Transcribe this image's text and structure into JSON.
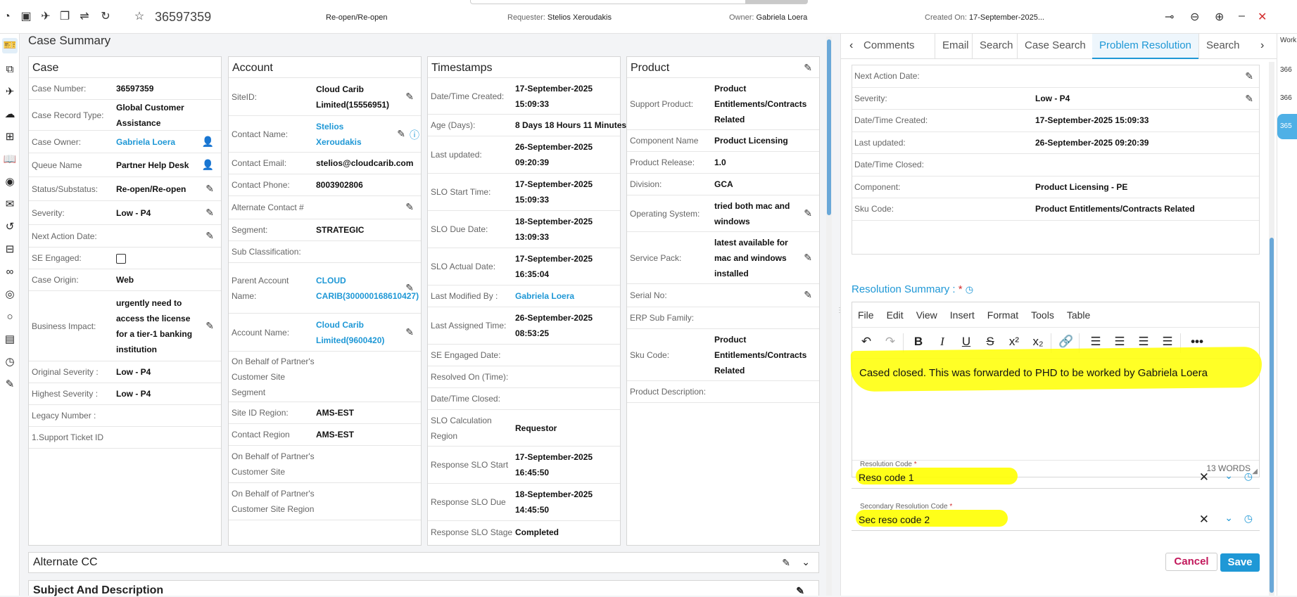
{
  "topbar": {
    "case_id": "36597359",
    "status": "Re-open/Re-open",
    "requester_label": "Requester:",
    "requester": "Stelios Xeroudakis",
    "owner_label": "Owner:",
    "owner": "Gabriela Loera",
    "created_label": "Created On:",
    "created": "17-September-2025..."
  },
  "page_title": "Case Summary",
  "case_panel": {
    "title": "Case",
    "rows": [
      {
        "label": "Case Number:",
        "value": "36597359"
      },
      {
        "label": "Case Record Type:",
        "value": "Global Customer Assistance"
      },
      {
        "label": "Case Owner:",
        "value": "Gabriela Loera"
      },
      {
        "label": "Queue Name",
        "value": "Partner Help Desk"
      },
      {
        "label": "Status/Substatus:",
        "value": "Re-open/Re-open"
      },
      {
        "label": "Severity:",
        "value": "Low - P4"
      },
      {
        "label": "Next Action Date:",
        "value": ""
      },
      {
        "label": "SE Engaged:",
        "value": ""
      },
      {
        "label": "Case Origin:",
        "value": "Web"
      },
      {
        "label": "Business Impact:",
        "value": "urgently need to access the license for a tier-1 banking institution"
      },
      {
        "label": "Original Severity :",
        "value": "Low - P4"
      },
      {
        "label": "Highest Severity :",
        "value": "Low - P4"
      },
      {
        "label": "Legacy Number :",
        "value": ""
      },
      {
        "label": "1.Support Ticket ID",
        "value": ""
      }
    ]
  },
  "account_panel": {
    "title": "Account",
    "rows": [
      {
        "label": "SiteID:",
        "value": "Cloud Carib Limited(15556951)"
      },
      {
        "label": "Contact Name:",
        "value": "Stelios Xeroudakis"
      },
      {
        "label": "Contact Email:",
        "value": "stelios@cloudcarib.com"
      },
      {
        "label": "Contact Phone:",
        "value": "8003902806"
      },
      {
        "label": "Alternate Contact #",
        "value": ""
      },
      {
        "label": "Segment:",
        "value": "STRATEGIC"
      },
      {
        "label": "Sub Classification:",
        "value": ""
      },
      {
        "label": "Parent Account Name:",
        "value": "CLOUD CARIB(300000168610427)"
      },
      {
        "label": "Account Name:",
        "value": "Cloud Carib Limited(9600420)"
      },
      {
        "label": "On Behalf of Partner's Customer Site Segment",
        "value": ""
      },
      {
        "label": "Site ID Region:",
        "value": "AMS-EST"
      },
      {
        "label": "Contact Region",
        "value": "AMS-EST"
      },
      {
        "label": "On Behalf of Partner's Customer Site",
        "value": ""
      },
      {
        "label": "On Behalf of Partner's Customer Site Region",
        "value": ""
      }
    ]
  },
  "timestamps_panel": {
    "title": "Timestamps",
    "rows": [
      {
        "label": "Date/Time Created:",
        "value": "17-September-2025 15:09:33"
      },
      {
        "label": "Age (Days):",
        "value": "8 Days 18 Hours 11 Minutes"
      },
      {
        "label": "Last updated:",
        "value": "26-September-2025 09:20:39"
      },
      {
        "label": "SLO Start Time:",
        "value": "17-September-2025 15:09:33"
      },
      {
        "label": "SLO Due Date:",
        "value": "18-September-2025 13:09:33"
      },
      {
        "label": "SLO Actual Date:",
        "value": "17-September-2025 16:35:04"
      },
      {
        "label": "Last Modified By :",
        "value": "Gabriela Loera"
      },
      {
        "label": "Last Assigned Time:",
        "value": "26-September-2025 08:53:25"
      },
      {
        "label": "SE Engaged Date:",
        "value": ""
      },
      {
        "label": "Resolved On (Time):",
        "value": ""
      },
      {
        "label": "Date/Time Closed:",
        "value": ""
      },
      {
        "label": "SLO Calculation Region",
        "value": "Requestor"
      },
      {
        "label": "Response SLO Start",
        "value": "17-September-2025 16:45:50"
      },
      {
        "label": "Response SLO Due",
        "value": "18-September-2025 14:45:50"
      },
      {
        "label": "Response SLO Stage",
        "value": "Completed"
      }
    ]
  },
  "product_panel": {
    "title": "Product",
    "rows": [
      {
        "label": "Support Product:",
        "value": "Product Entitlements/Contracts Related"
      },
      {
        "label": "Component Name",
        "value": "Product Licensing"
      },
      {
        "label": "Product Release:",
        "value": "1.0"
      },
      {
        "label": "Division:",
        "value": "GCA"
      },
      {
        "label": "Operating System:",
        "value": "tried both mac and windows"
      },
      {
        "label": "Service Pack:",
        "value": "latest available for mac and windows installed"
      },
      {
        "label": "Serial No:",
        "value": ""
      },
      {
        "label": "ERP Sub Family:",
        "value": ""
      },
      {
        "label": "Sku Code:",
        "value": "Product Entitlements/Contracts Related"
      },
      {
        "label": "Product Description:",
        "value": ""
      }
    ]
  },
  "accordions": {
    "alternate_cc": "Alternate CC",
    "subject": "Subject And Description"
  },
  "right_tabs": [
    "Comments",
    "Email",
    "Search",
    "Case Search",
    "Problem Resolution",
    "Search"
  ],
  "right_details": [
    {
      "label": "Next Action Date:",
      "value": ""
    },
    {
      "label": "Severity:",
      "value": "Low - P4"
    },
    {
      "label": "Date/Time Created:",
      "value": "17-September-2025 15:09:33"
    },
    {
      "label": "Last updated:",
      "value": "26-September-2025 09:20:39"
    },
    {
      "label": "Date/Time Closed:",
      "value": ""
    },
    {
      "label": "Component:",
      "value": "Product Licensing - PE"
    },
    {
      "label": "Sku Code:",
      "value": "Product Entitlements/Contracts Related"
    }
  ],
  "resolution": {
    "label": "Resolution Summary :",
    "required_mark": "*",
    "menu": [
      "File",
      "Edit",
      "View",
      "Insert",
      "Format",
      "Tools",
      "Table"
    ],
    "text": "Cased closed. This was forwarded to PHD to be worked by Gabriela Loera",
    "word_count": "13 WORDS"
  },
  "resolution_code": {
    "label": "Resolution Code",
    "required_mark": "*",
    "value": "Reso code 1"
  },
  "secondary_code": {
    "label": "Secondary Resolution Code",
    "required_mark": "*",
    "value": "Sec reso code 2"
  },
  "buttons": {
    "cancel": "Cancel",
    "save": "Save"
  },
  "far_right": [
    "Work",
    "366",
    "366",
    "365"
  ],
  "colors": {
    "accent": "#1f98d6",
    "highlight": "#ffff00",
    "cancel": "#c2185b"
  }
}
